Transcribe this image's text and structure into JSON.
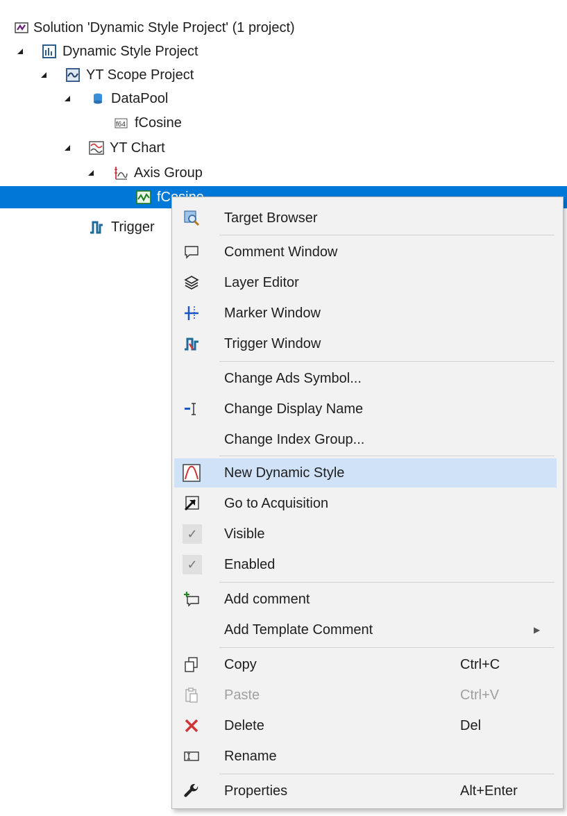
{
  "tree": [
    {
      "label": "Solution 'Dynamic Style Project' (1 project)",
      "icon": "solution-icon",
      "expanded": null
    },
    {
      "label": "Dynamic Style Project",
      "icon": "project-icon",
      "expanded": true
    },
    {
      "label": "YT Scope Project",
      "icon": "scope-project-icon",
      "expanded": true
    },
    {
      "label": "DataPool",
      "icon": "datapool-icon",
      "expanded": true
    },
    {
      "label": "fCosine",
      "icon": "float64-icon",
      "expanded": null
    },
    {
      "label": "YT Chart",
      "icon": "yt-chart-icon",
      "expanded": true
    },
    {
      "label": "Axis Group",
      "icon": "axis-group-icon",
      "expanded": true
    },
    {
      "label": "fCosine",
      "icon": "channel-icon",
      "expanded": null,
      "selected": true
    },
    {
      "label": "Trigger",
      "icon": "trigger-icon",
      "expanded": null
    }
  ],
  "menu": [
    {
      "label": "Target Browser",
      "icon": "target-browser-icon",
      "shortcut": ""
    },
    {
      "label": "Comment Window",
      "icon": "comment-icon",
      "shortcut": ""
    },
    {
      "label": "Layer Editor",
      "icon": "layers-icon",
      "shortcut": ""
    },
    {
      "label": "Marker Window",
      "icon": "marker-icon",
      "shortcut": ""
    },
    {
      "label": "Trigger Window",
      "icon": "trigger-window-icon",
      "shortcut": ""
    },
    {
      "label": "Change Ads Symbol...",
      "icon": "",
      "shortcut": ""
    },
    {
      "label": "Change Display Name",
      "icon": "rename-field-icon",
      "shortcut": ""
    },
    {
      "label": "Change Index Group...",
      "icon": "",
      "shortcut": ""
    },
    {
      "label": "New Dynamic Style",
      "icon": "dynamic-style-icon",
      "shortcut": "",
      "highlighted": true
    },
    {
      "label": "Go to Acquisition",
      "icon": "goto-icon",
      "shortcut": ""
    },
    {
      "label": "Visible",
      "icon": "check-icon",
      "shortcut": "",
      "checked": true
    },
    {
      "label": "Enabled",
      "icon": "check-icon",
      "shortcut": "",
      "checked": true
    },
    {
      "label": "Add comment",
      "icon": "add-comment-icon",
      "shortcut": ""
    },
    {
      "label": "Add Template Comment",
      "icon": "",
      "shortcut": "",
      "submenu": true
    },
    {
      "label": "Copy",
      "icon": "copy-icon",
      "shortcut": "Ctrl+C"
    },
    {
      "label": "Paste",
      "icon": "paste-icon",
      "shortcut": "Ctrl+V",
      "disabled": true
    },
    {
      "label": "Delete",
      "icon": "delete-icon",
      "shortcut": "Del"
    },
    {
      "label": "Rename",
      "icon": "rename-icon",
      "shortcut": ""
    },
    {
      "label": "Properties",
      "icon": "wrench-icon",
      "shortcut": "Alt+Enter"
    }
  ],
  "colors": {
    "selection": "#0078d7",
    "menu_highlight": "#cfe2f7",
    "delete_red": "#d13438",
    "brand_purple": "#68217a"
  }
}
